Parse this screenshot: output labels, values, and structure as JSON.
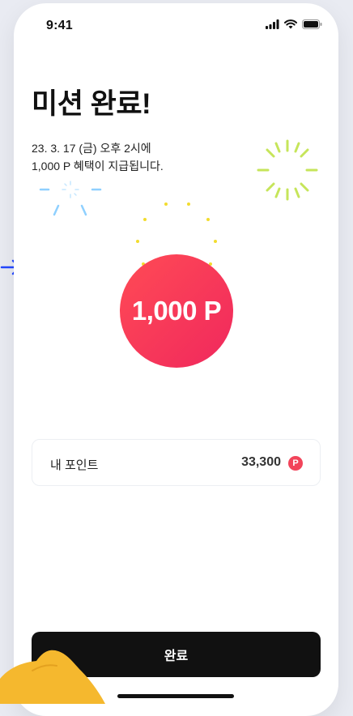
{
  "status_bar": {
    "time": "9:41",
    "icons": [
      "signal-icon",
      "wifi-icon",
      "battery-icon"
    ]
  },
  "screen": {
    "title": "미션 완료!",
    "description_lines": [
      "23. 3. 17 (금) 오후 2시에",
      "1,000 P 혜택이 지급됩니다."
    ],
    "reward": "1,000 P"
  },
  "point_card": {
    "label": "내 포인트",
    "value": "33,300",
    "badge": "P"
  },
  "confirm_button": {
    "label": "완료"
  },
  "colors": {
    "accent_red": "#f0285d",
    "spark_yellow": "#c6e55a",
    "spark_blue": "#8fd0ff",
    "button_black": "#111111"
  }
}
